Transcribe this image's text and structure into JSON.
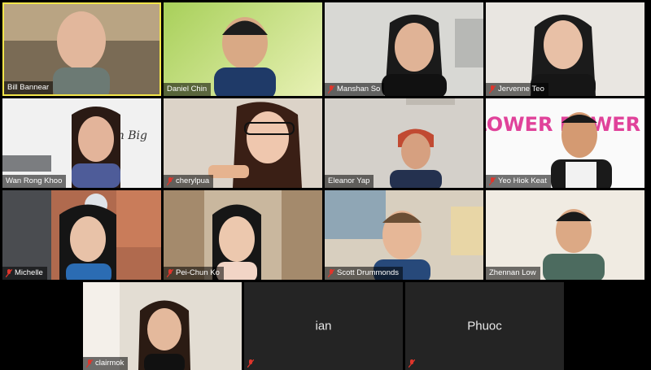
{
  "participants": [
    {
      "name": "Bill Bannear",
      "muted": false,
      "active": true
    },
    {
      "name": "Daniel Chin",
      "muted": false
    },
    {
      "name": "Manshan So",
      "muted": true
    },
    {
      "name": "Jervenne Teo",
      "muted": true
    },
    {
      "name": "Wan Rong Khoo",
      "muted": false
    },
    {
      "name": "cherylpua",
      "muted": true
    },
    {
      "name": "Eleanor Yap",
      "muted": false
    },
    {
      "name": "Yeo Hiok Keat",
      "muted": true
    },
    {
      "name": "Michelle",
      "muted": true
    },
    {
      "name": "Pei-Chun Ko",
      "muted": true
    },
    {
      "name": "Scott Drummonds",
      "muted": true
    },
    {
      "name": "Zhennan Low",
      "muted": false
    },
    {
      "name": "clairmok",
      "muted": true
    },
    {
      "name": "ian",
      "muted": true,
      "video_off": true
    },
    {
      "name": "Phuoc",
      "muted": true,
      "video_off": true
    }
  ],
  "backgrounds": {
    "dream_big_text": "Dream Big",
    "flower_power_text": "FLOWER POWER"
  },
  "colors": {
    "active_speaker_border": "#f3e54a",
    "muted_icon": "#e0352b",
    "tile_off": "#242424"
  }
}
